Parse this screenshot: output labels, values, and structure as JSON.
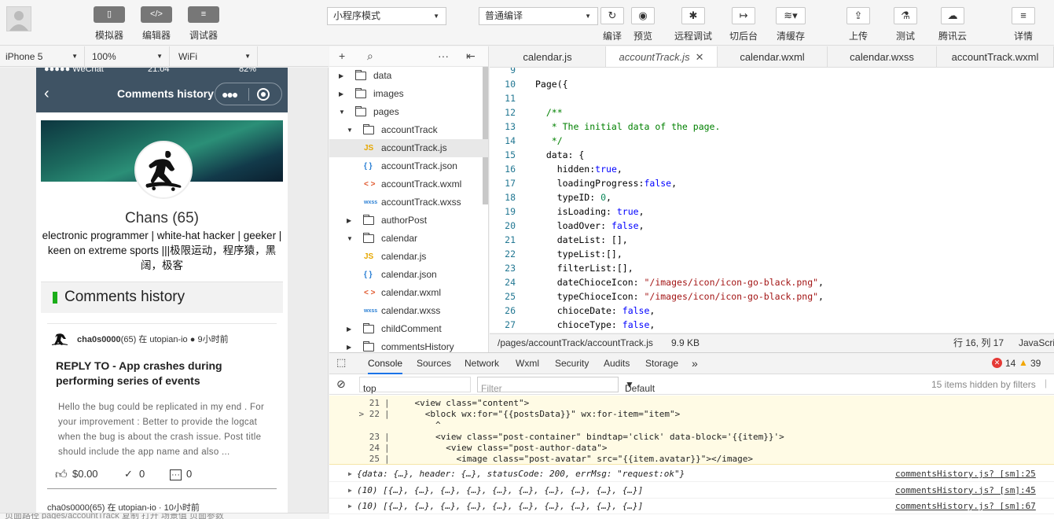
{
  "toolbar": {
    "sim_label": "模拟器",
    "editor_label": "编辑器",
    "debugger_label": "调试器",
    "mode_select": "小程序模式",
    "compile_select": "普通编译",
    "compile_label": "编译",
    "preview_label": "预览",
    "remote_debug_label": "远程调试",
    "background_label": "切后台",
    "clear_cache_label": "清缓存",
    "upload_label": "上传",
    "test_label": "测试",
    "tencent_cloud_label": "腾讯云",
    "details_label": "详情"
  },
  "device": {
    "model": "iPhone 5",
    "zoom": "100%",
    "network": "WiFi"
  },
  "phone": {
    "status_carrier": "●●●●● WeChat",
    "status_time": "21:04",
    "status_battery": "82%",
    "nav_title": "Comments history",
    "profile_name": "Chans (65)",
    "profile_bio": "electronic programmer | white-hat hacker | geeker | keen on extreme sports |||极限运动，程序猿，黑阔，极客",
    "section_title": "Comments history",
    "comment": {
      "author": "cha0s0000",
      "rep": "(65)",
      "in_text": " 在 utopian-io",
      "time": "9小时前",
      "title": "REPLY TO - App crashes during performing series of events",
      "body": "Hello the bug could be replicated in my end . For your improvement : Better to provide the logcat when the bug is about the crash issue. Post title should include the app name and also ...",
      "payout": "$0.00",
      "votes": "0",
      "replies": "0"
    },
    "comment2_meta": "cha0s0000(65) 在 utopian-io · 10小时前",
    "footer": "页面路径    pages/accountTrack    复制  打开    场景值    页面参数"
  },
  "filetree": {
    "items": [
      {
        "label": "data",
        "kind": "folder",
        "open": false
      },
      {
        "label": "images",
        "kind": "folder",
        "open": false
      },
      {
        "label": "pages",
        "kind": "folder",
        "open": true
      },
      {
        "label": "accountTrack",
        "kind": "folder",
        "open": true
      },
      {
        "label": "accountTrack.js",
        "kind": "js"
      },
      {
        "label": "accountTrack.json",
        "kind": "json"
      },
      {
        "label": "accountTrack.wxml",
        "kind": "wxml"
      },
      {
        "label": "accountTrack.wxss",
        "kind": "wxss"
      },
      {
        "label": "authorPost",
        "kind": "folder",
        "open": false
      },
      {
        "label": "calendar",
        "kind": "folder",
        "open": true
      },
      {
        "label": "calendar.js",
        "kind": "js"
      },
      {
        "label": "calendar.json",
        "kind": "json"
      },
      {
        "label": "calendar.wxml",
        "kind": "wxml"
      },
      {
        "label": "calendar.wxss",
        "kind": "wxss"
      },
      {
        "label": "childComment",
        "kind": "folder",
        "open": false
      },
      {
        "label": "commentsHistory",
        "kind": "folder",
        "open": false
      }
    ]
  },
  "tabs": [
    {
      "label": "calendar.js",
      "active": false
    },
    {
      "label": "accountTrack.js",
      "active": true
    },
    {
      "label": "calendar.wxml",
      "active": false
    },
    {
      "label": "calendar.wxss",
      "active": false
    },
    {
      "label": "accountTrack.wxml",
      "active": false
    }
  ],
  "code": [
    {
      "n": "9",
      "t": ""
    },
    {
      "n": "10",
      "t": "Page({"
    },
    {
      "n": "11",
      "t": ""
    },
    {
      "n": "12",
      "t": "  /**",
      "c": "com"
    },
    {
      "n": "13",
      "t": "   * The initial data of the page.",
      "c": "com"
    },
    {
      "n": "14",
      "t": "   */",
      "c": "com"
    },
    {
      "n": "15",
      "t": "  data: {"
    },
    {
      "n": "16",
      "t": "    hidden:true,"
    },
    {
      "n": "17",
      "t": "    loadingProgress:false,"
    },
    {
      "n": "18",
      "t": "    typeID: 0,"
    },
    {
      "n": "19",
      "t": "    isLoading: true,"
    },
    {
      "n": "20",
      "t": "    loadOver: false,"
    },
    {
      "n": "21",
      "t": "    dateList: [],"
    },
    {
      "n": "22",
      "t": "    typeList:[],"
    },
    {
      "n": "23",
      "t": "    filterList:[],"
    },
    {
      "n": "24",
      "t": "    dateChioceIcon: \"/images/icon/icon-go-black.png\","
    },
    {
      "n": "25",
      "t": "    typeChioceIcon: \"/images/icon/icon-go-black.png\","
    },
    {
      "n": "26",
      "t": "    chioceDate: false,"
    },
    {
      "n": "27",
      "t": "    chioceType: false,"
    }
  ],
  "status": {
    "path": "/pages/accountTrack/accountTrack.js",
    "size": "9.9 KB",
    "cursor": "行 16, 列 17",
    "lang": "JavaScript"
  },
  "devtools": {
    "tabs": [
      "Console",
      "Sources",
      "Network",
      "Wxml",
      "Security",
      "Audits",
      "Storage"
    ],
    "more": "»",
    "errors": "14",
    "warnings": "39",
    "context": "top",
    "filter_placeholder": "Filter",
    "levels": "Default levels",
    "hidden": "15 items hidden by filters",
    "error_lines": [
      {
        "n": "21",
        "t": "    <view class=\"content\">"
      },
      {
        "n": "> 22",
        "t": "      <block wx:for=\"{{postsData}}\" wx:for-item=\"item\">"
      },
      {
        "n": "",
        "t": "        ^"
      },
      {
        "n": "23",
        "t": "        <view class=\"post-container\" bindtap='click' data-block='{{item}}'>"
      },
      {
        "n": "24",
        "t": "          <view class=\"post-author-data\">"
      },
      {
        "n": "25",
        "t": "            <image class=\"post-avatar\" src=\"{{item.avatar}}\"></image>"
      }
    ],
    "logs": [
      {
        "msg": "{data: {…}, header: {…}, statusCode: 200, errMsg: \"request:ok\"}",
        "src": "commentsHistory.js? [sm]:25"
      },
      {
        "msg": "(10) [{…}, {…}, {…}, {…}, {…}, {…}, {…}, {…}, {…}, {…}]",
        "src": "commentsHistory.js? [sm]:45"
      },
      {
        "msg": "(10) [{…}, {…}, {…}, {…}, {…}, {…}, {…}, {…}, {…}, {…}]",
        "src": "commentsHistory.js? [sm]:67"
      }
    ]
  }
}
